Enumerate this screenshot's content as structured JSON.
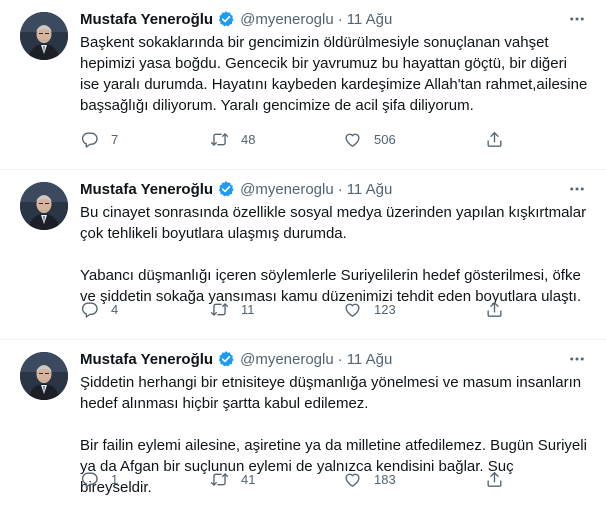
{
  "tweets": [
    {
      "author": "Mustafa Yeneroğlu",
      "handle": "@myeneroglu",
      "separator": "·",
      "date": "11 Ağu",
      "paragraphs": [
        "Başkent sokaklarında bir gencimizin öldürülmesiyle sonuçlanan vahşet hepimizi yasa boğdu. Gencecik bir yavrumuz bu hayattan göçtü, bir diğeri ise yaralı durumda. Hayatını kaybeden kardeşimize Allah'tan rahmet,ailesine başsağlığı diliyorum. Yaralı gencimize de acil şifa diliyorum."
      ],
      "replies": "7",
      "retweets": "48",
      "likes": "506"
    },
    {
      "author": "Mustafa Yeneroğlu",
      "handle": "@myeneroglu",
      "separator": "·",
      "date": "11 Ağu",
      "paragraphs": [
        "Bu cinayet sonrasında özellikle sosyal medya üzerinden yapılan kışkırtmalar çok tehlikeli boyutlara ulaşmış durumda.",
        "Yabancı düşmanlığı içeren söylemlerle Suriyelilerin hedef gösterilmesi, öfke ve şiddetin sokağa yansıması kamu düzenimizi tehdit eden boyutlara ulaştı."
      ],
      "replies": "4",
      "retweets": "11",
      "likes": "123"
    },
    {
      "author": "Mustafa Yeneroğlu",
      "handle": "@myeneroglu",
      "separator": "·",
      "date": "11 Ağu",
      "paragraphs": [
        "Şiddetin herhangi bir etnisiteye düşmanlığa yönelmesi ve masum insanların hedef alınması hiçbir şartta kabul edilemez.",
        "Bir failin eylemi ailesine, aşiretine ya da milletine atfedilemez. Bugün Suriyeli ya da Afgan bir suçlunun eylemi de yalnızca kendisini bağlar. Suç bireyseldir."
      ],
      "replies": "1",
      "retweets": "41",
      "likes": "183"
    }
  ],
  "icons": {
    "verified": "verified-badge-icon",
    "more": "more-dots-icon",
    "reply": "reply-icon",
    "retweet": "retweet-icon",
    "like": "heart-icon",
    "share": "share-icon"
  },
  "colors": {
    "text": "#0f1419",
    "secondary": "#536471",
    "verified": "#1d9bf0",
    "divider": "#eff3f4"
  }
}
